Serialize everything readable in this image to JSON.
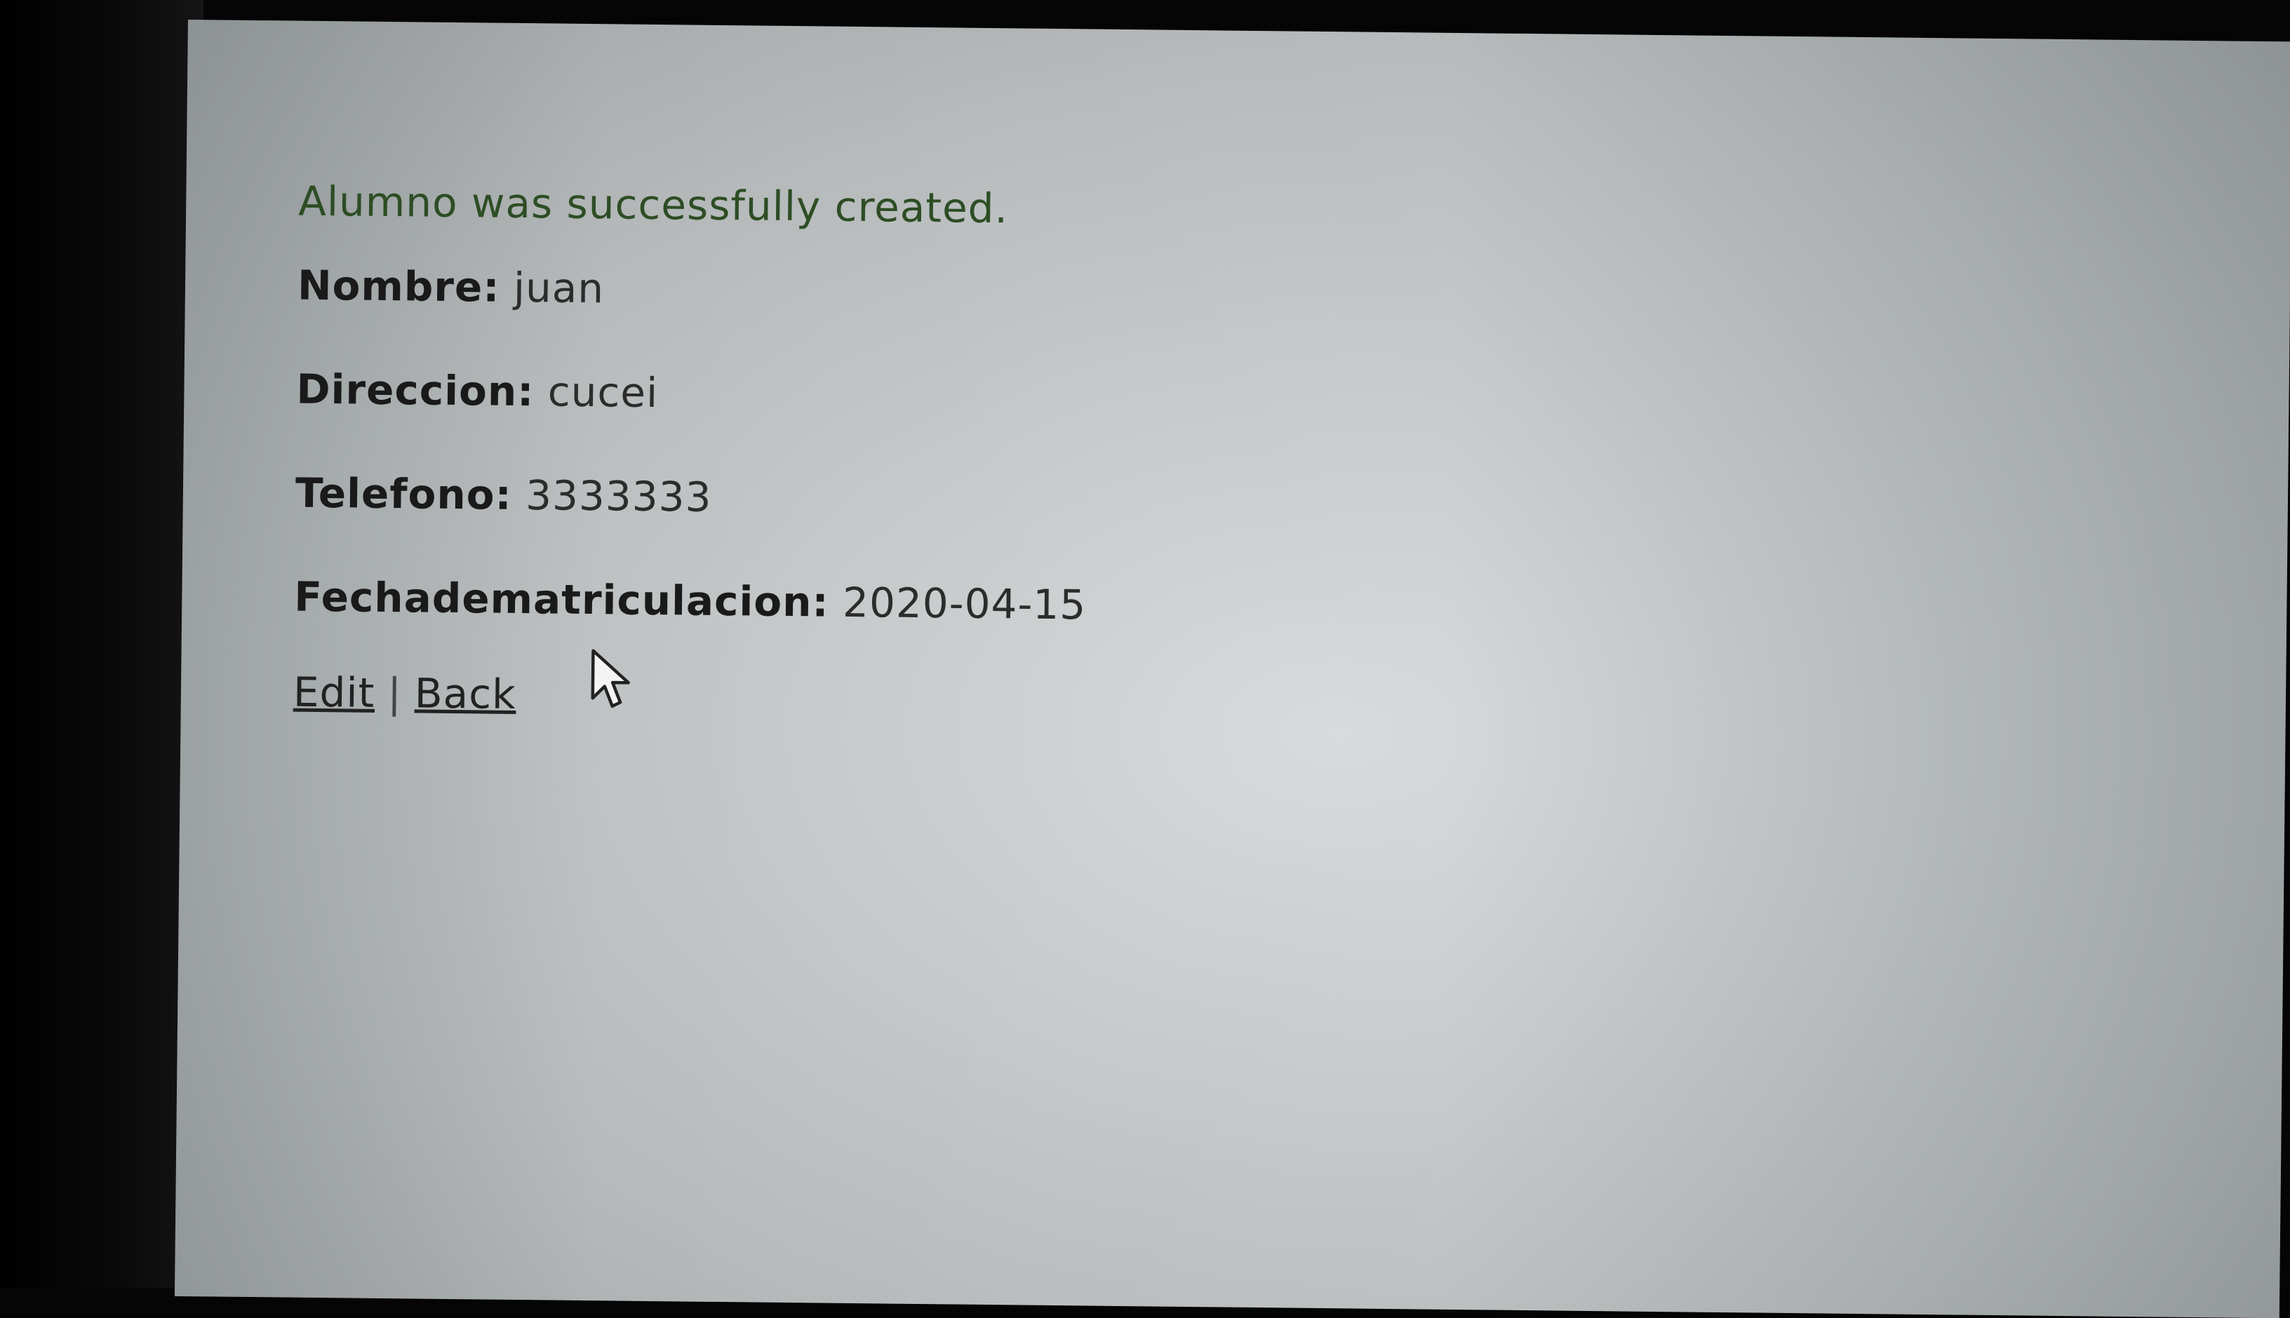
{
  "notice": "Alumno was successfully created.",
  "fields": [
    {
      "label": "Nombre:",
      "value": "juan"
    },
    {
      "label": "Direccion:",
      "value": "cucei"
    },
    {
      "label": "Telefono:",
      "value": "3333333"
    },
    {
      "label": "Fechadematriculacion:",
      "value": "2020-04-15"
    }
  ],
  "actions": {
    "edit_label": "Edit",
    "separator": "|",
    "back_label": "Back"
  },
  "icons": {
    "cursor": "mouse-pointer-icon"
  }
}
